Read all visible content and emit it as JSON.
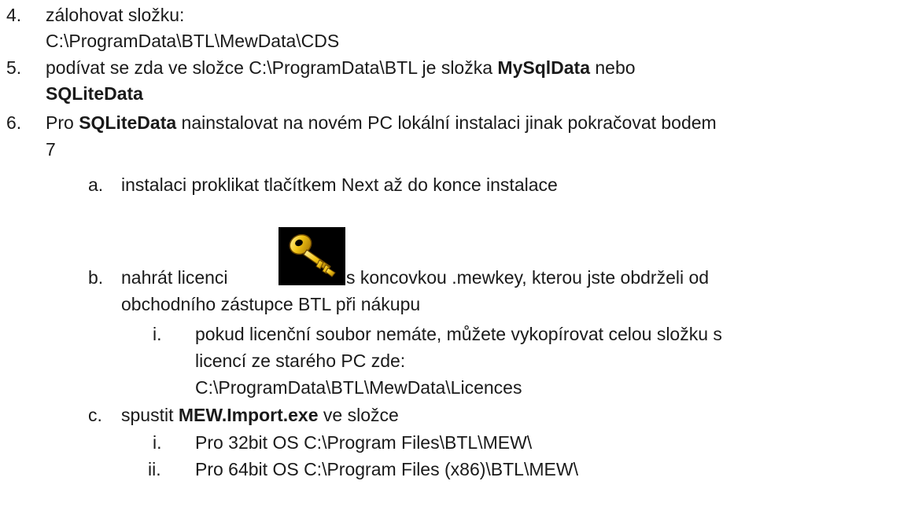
{
  "items": {
    "i4": {
      "num": "4.",
      "text": "zálohovat složku:",
      "cont": "C:\\ProgramData\\BTL\\MewData\\CDS"
    },
    "i5": {
      "num": "5.",
      "pre": "podívat se zda ve složce C:\\ProgramData\\BTL je složka ",
      "b1": "MySqlData",
      "mid": " nebo",
      "b2": "SQLiteData"
    },
    "i6": {
      "num": "6.",
      "pre": "Pro ",
      "b": "SQLiteData",
      "post": " nainstalovat na novém PC lokální instalaci jinak pokračovat bodem",
      "cont": "7"
    },
    "a": {
      "num": "a.",
      "text": "instalaci proklikat tlačítkem Next až do konce instalace"
    },
    "b": {
      "num": "b.",
      "pre": "nahrát licenci",
      "post": "s koncovkou .mewkey, kterou jste obdrželi od",
      "cont": "obchodního zástupce BTL při nákupu",
      "icon": "key-icon"
    },
    "bi": {
      "num": "i.",
      "text": "pokud licenční soubor nemáte, můžete vykopírovat celou složku s",
      "cont1": "licencí ze starého PC zde:",
      "cont2": "C:\\ProgramData\\BTL\\MewData\\Licences"
    },
    "c": {
      "num": "c.",
      "pre": "spustit ",
      "b": "MEW.Import.exe",
      "post": " ve složce"
    },
    "ci": {
      "num": "i.",
      "text": "Pro 32bit OS C:\\Program Files\\BTL\\MEW\\"
    },
    "cii": {
      "num": "ii.",
      "text": "Pro 64bit OS C:\\Program Files (x86)\\BTL\\MEW\\"
    }
  }
}
